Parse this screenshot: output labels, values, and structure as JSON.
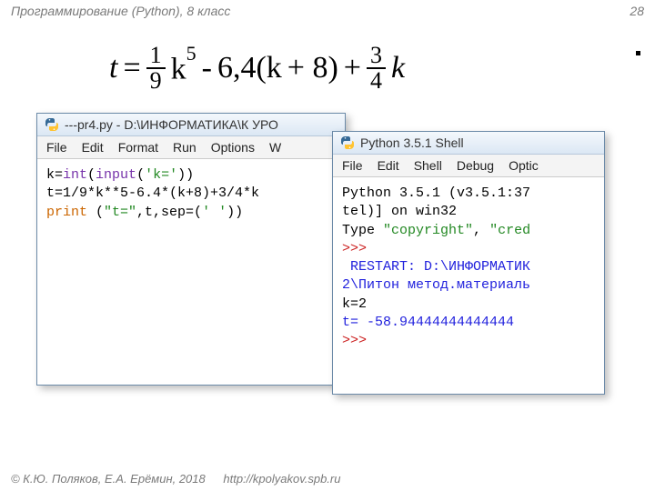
{
  "header": {
    "title": "Программирование (Python), 8 класс",
    "page_number": "28"
  },
  "formula": {
    "t": "t",
    "eq": "=",
    "frac1_num": "1",
    "frac1_den": "9",
    "k": "k",
    "exp5": "5",
    "minus": "-",
    "coef": "6,4(k",
    "plus8": "+ 8)",
    "plus": "+",
    "frac2_num": "3",
    "frac2_den": "4",
    "k2": "k"
  },
  "editor_window": {
    "title": "---pr4.py - D:\\ИНФОРМАТИКА\\К УРО",
    "menu": {
      "file": "File",
      "edit": "Edit",
      "format": "Format",
      "run": "Run",
      "options": "Options",
      "w": "W"
    },
    "code": {
      "l1a": "k=",
      "l1b": "int",
      "l1c": "(",
      "l1d": "input",
      "l1e": "(",
      "l1f": "'k='",
      "l1g": "))",
      "l2": "t=1/9*k**5-6.4*(k+8)+3/4*k",
      "l3a": "print",
      "l3b": " (",
      "l3c": "\"t=\"",
      "l3d": ",t,sep=(",
      "l3e": "' '",
      "l3f": "))"
    }
  },
  "shell_window": {
    "title": "Python 3.5.1 Shell",
    "menu": {
      "file": "File",
      "edit": "Edit",
      "shell": "Shell",
      "debug": "Debug",
      "optic": "Optic"
    },
    "out": {
      "l1": "Python 3.5.1 (v3.5.1:37",
      "l2": "tel)] on win32",
      "l3a": "Type ",
      "l3b": "\"copyright\"",
      "l3c": ", ",
      "l3d": "\"cred",
      "l4": ">>>",
      "l5": " RESTART: D:\\ИНФОРМАТИК",
      "l6": "2\\Питон метод.материаль",
      "l7": "k=2",
      "l8": "t= -58.94444444444444",
      "l9": ">>>"
    }
  },
  "footer": {
    "copyright": "© К.Ю. Поляков, Е.А. Ерёмин, 2018",
    "url": "http://kpolyakov.spb.ru"
  }
}
